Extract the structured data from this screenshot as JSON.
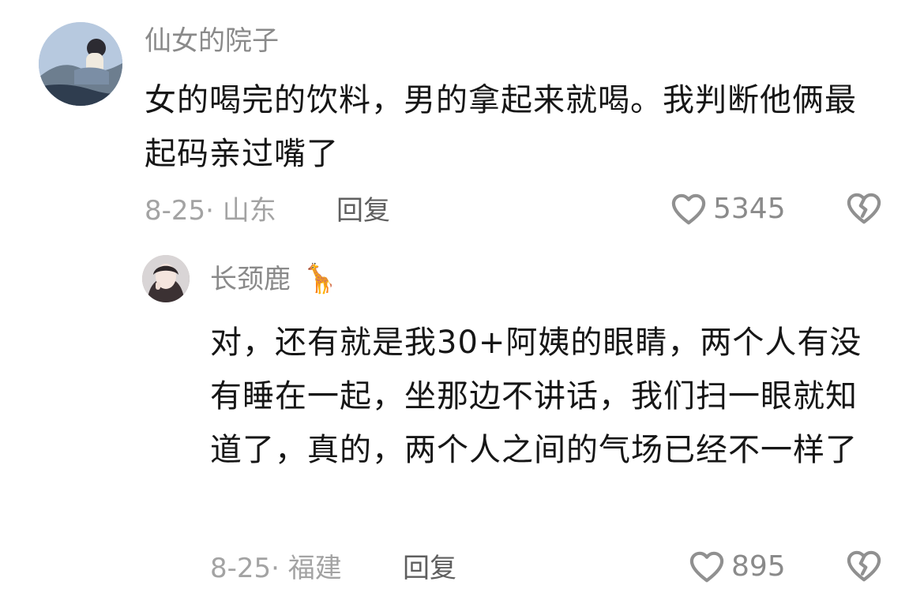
{
  "comments": [
    {
      "username": "仙女的院子",
      "text": "女的喝完的饮料，男的拿起来就喝。我判断他俩最起码亲过嘴了",
      "date_location": "8-25· 山东",
      "reply_label": "回复",
      "likes": "5345",
      "icons": {
        "like": "heart-outline-icon",
        "dislike": "broken-heart-icon"
      }
    },
    {
      "username": "长颈鹿",
      "username_emoji": "🦒",
      "text": "对，还有就是我30+阿姨的眼睛，两个人有没有睡在一起，坐那边不讲话，我们扫一眼就知道了，真的，两个人之间的气场已经不一样了",
      "date_location": "8-25· 福建",
      "reply_label": "回复",
      "likes": "895",
      "icons": {
        "like": "heart-outline-icon",
        "dislike": "broken-heart-icon"
      }
    }
  ],
  "colors": {
    "text": "#161616",
    "username": "#8a8a8a",
    "meta": "#a3a3a3",
    "reply": "#5f5f5f"
  }
}
